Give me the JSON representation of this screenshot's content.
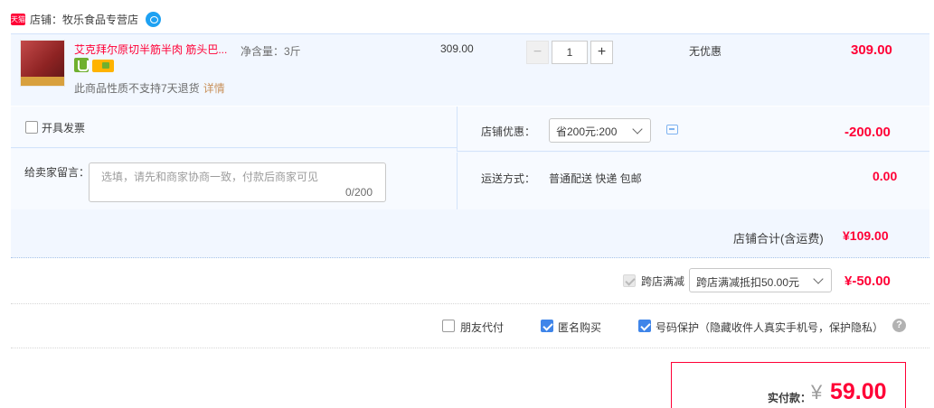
{
  "shop": {
    "badge": "天猫",
    "label": "店铺：牧乐食品专营店",
    "chat_icon": "wangwang-icon"
  },
  "item": {
    "title": "艾克拜尔原切半筋半肉 筋头巴...",
    "sku": "净含量：3斤",
    "notice": "此商品性质不支持7天退货",
    "notice_link": "详情",
    "unit_price": "309.00",
    "quantity": "1",
    "discount_text": "无优惠",
    "total": "309.00"
  },
  "options": {
    "invoice_label": "开具发票",
    "message_label": "给卖家留言：",
    "message_placeholder": "选填，请先和商家协商一致，付款后商家可见",
    "message_count": "0/200",
    "shop_discount_label": "店铺优惠：",
    "shop_discount_value": "省200元:200",
    "shop_discount_amount": "-200.00",
    "shipping_label": "运送方式：",
    "shipping_value": "普通配送 快递 包邮",
    "shipping_amount": "0.00",
    "shop_total_label": "店铺合计(含运费)",
    "shop_total_amount": "¥109.00"
  },
  "cross_store": {
    "label": "跨店满减",
    "select_value": "跨店满减抵扣50.00元",
    "amount": "¥-50.00"
  },
  "extras": {
    "friend_pay_label": "朋友代付",
    "anonymous_label": "匿名购买",
    "privacy_label": "号码保护（隐藏收件人真实手机号，保护隐私）",
    "help_symbol": "?"
  },
  "payment": {
    "label": "实付款：",
    "currency": "¥",
    "amount": "59.00"
  },
  "colors": {
    "accent_red": "#ff0036",
    "checkbox_blue": "#3f85e9",
    "panel_bg": "#f2f7ff"
  }
}
